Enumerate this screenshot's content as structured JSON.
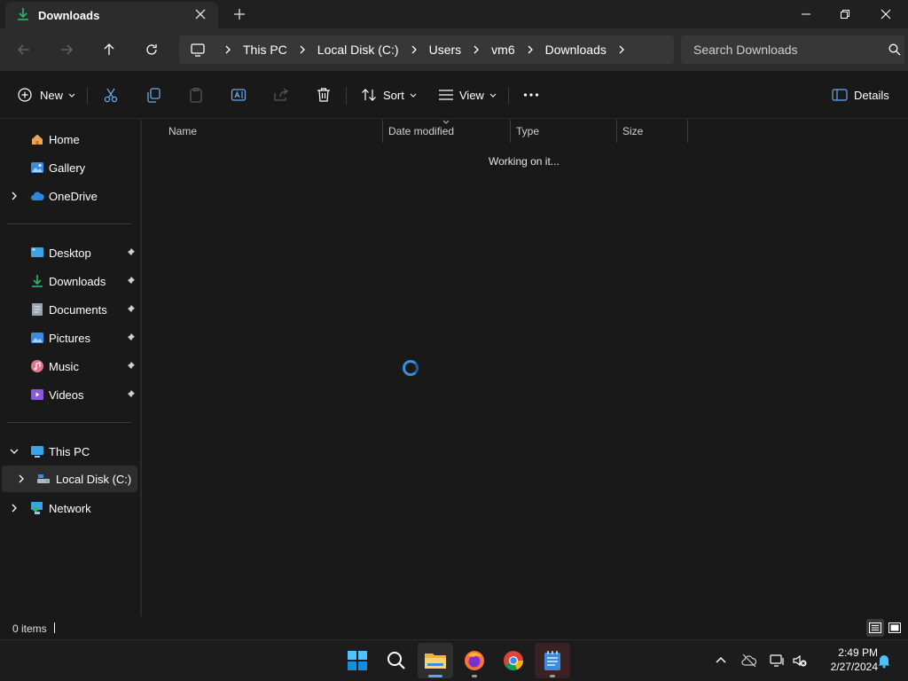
{
  "window": {
    "tab_title": "Downloads"
  },
  "address": {
    "crumbs": [
      "This PC",
      "Local Disk (C:)",
      "Users",
      "vm6",
      "Downloads"
    ],
    "search_placeholder": "Search Downloads"
  },
  "commands": {
    "new": "New",
    "sort": "Sort",
    "view": "View",
    "details": "Details"
  },
  "sidebar": {
    "quick": [
      "Home",
      "Gallery",
      "OneDrive"
    ],
    "pinned": [
      "Desktop",
      "Downloads",
      "Documents",
      "Pictures",
      "Music",
      "Videos"
    ],
    "tree": [
      "This PC",
      "Local Disk (C:)",
      "Network"
    ]
  },
  "columns": {
    "name": "Name",
    "date": "Date modified",
    "type": "Type",
    "size": "Size"
  },
  "content": {
    "status_message": "Working on it..."
  },
  "status": {
    "items": "0 items"
  },
  "clock": {
    "time": "2:49 PM",
    "date": "2/27/2024"
  },
  "colors": {
    "accent": "#3b8fd9",
    "background": "#191919",
    "chrome": "#2c2c2c"
  }
}
